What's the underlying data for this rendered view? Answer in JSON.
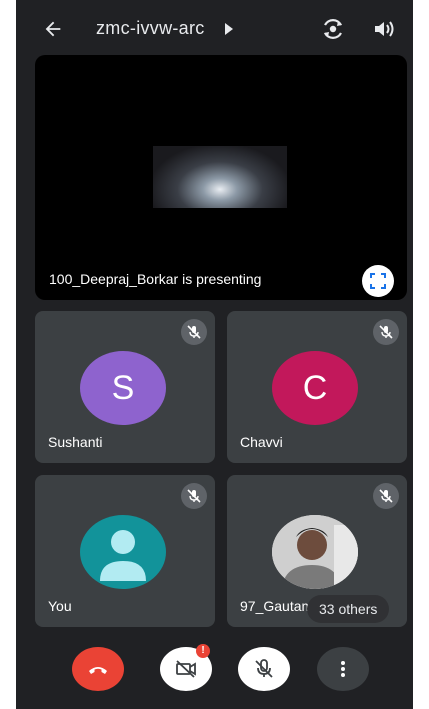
{
  "header": {
    "meeting_code": "zmc-ivvw-arc",
    "icons": [
      "back-arrow-icon",
      "caret-right-icon",
      "switch-camera-icon",
      "speaker-icon"
    ]
  },
  "presentation": {
    "label": "100_Deepraj_Borkar is presenting",
    "fullscreen_icon": "fullscreen-icon"
  },
  "participants": [
    {
      "name": "Sushanti",
      "initial": "S",
      "avatar_color": "#8e63ce",
      "muted": true
    },
    {
      "name": "Chavvi",
      "initial": "C",
      "avatar_color": "#c2185b",
      "muted": true
    },
    {
      "name": "You",
      "initial": "",
      "avatar_color": "#12939a",
      "muted": true
    },
    {
      "name": "97_Gautam",
      "initial": "",
      "avatar_color": "#5b5b5b",
      "muted": true
    }
  ],
  "others_count_label": "33 others",
  "controls": {
    "end_call_icon": "phone-hangup-icon",
    "camera_icon": "camera-off-icon",
    "camera_alert": "!",
    "mic_icon": "mic-off-icon",
    "more_icon": "more-vertical-icon"
  },
  "colors": {
    "background": "#202124",
    "tile": "#3c4043",
    "end_call": "#ea4335",
    "text": "#e8eaed"
  }
}
